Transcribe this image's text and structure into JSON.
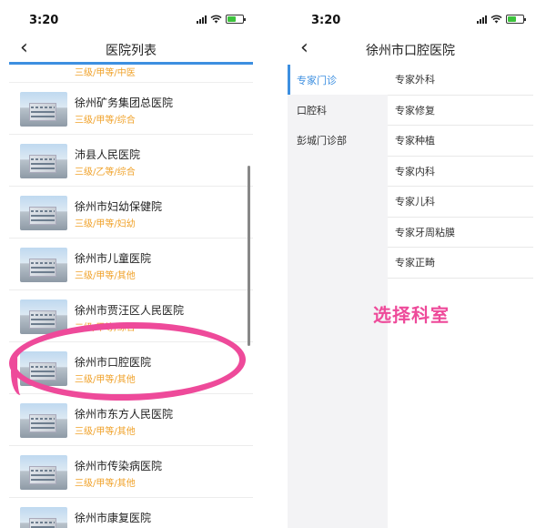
{
  "left_screen": {
    "status": {
      "time": "3:20"
    },
    "nav": {
      "back": "‹",
      "title": "医院列表"
    },
    "partial_tag": "三级/甲等/中医",
    "hospitals": [
      {
        "name": "徐州矿务集团总医院",
        "tag": "三级/甲等/综合"
      },
      {
        "name": "沛县人民医院",
        "tag": "三级/乙等/综合"
      },
      {
        "name": "徐州市妇幼保健院",
        "tag": "三级/甲等/妇幼"
      },
      {
        "name": "徐州市儿童医院",
        "tag": "三级/甲等/其他"
      },
      {
        "name": "徐州市贾汪区人民医院",
        "tag": "二级/甲等/综合"
      },
      {
        "name": "徐州市口腔医院",
        "tag": "三级/甲等/其他"
      },
      {
        "name": "徐州市东方人民医院",
        "tag": "三级/甲等/其他"
      },
      {
        "name": "徐州市传染病医院",
        "tag": "三级/甲等/其他"
      },
      {
        "name": "徐州市康复医院",
        "tag": ""
      }
    ]
  },
  "right_screen": {
    "status": {
      "time": "3:20"
    },
    "nav": {
      "back": "‹",
      "title": "徐州市口腔医院"
    },
    "categories": [
      {
        "label": "专家门诊",
        "active": true
      },
      {
        "label": "口腔科",
        "active": false
      },
      {
        "label": "彭城门诊部",
        "active": false
      }
    ],
    "departments": [
      "专家外科",
      "专家修复",
      "专家种植",
      "专家内科",
      "专家儿科",
      "专家牙周粘膜",
      "专家正畸"
    ],
    "annotation": "选择科室"
  },
  "colors": {
    "accent": "#3d8fe0",
    "tag": "#f0a22a",
    "highlight": "#ee4a9a"
  }
}
